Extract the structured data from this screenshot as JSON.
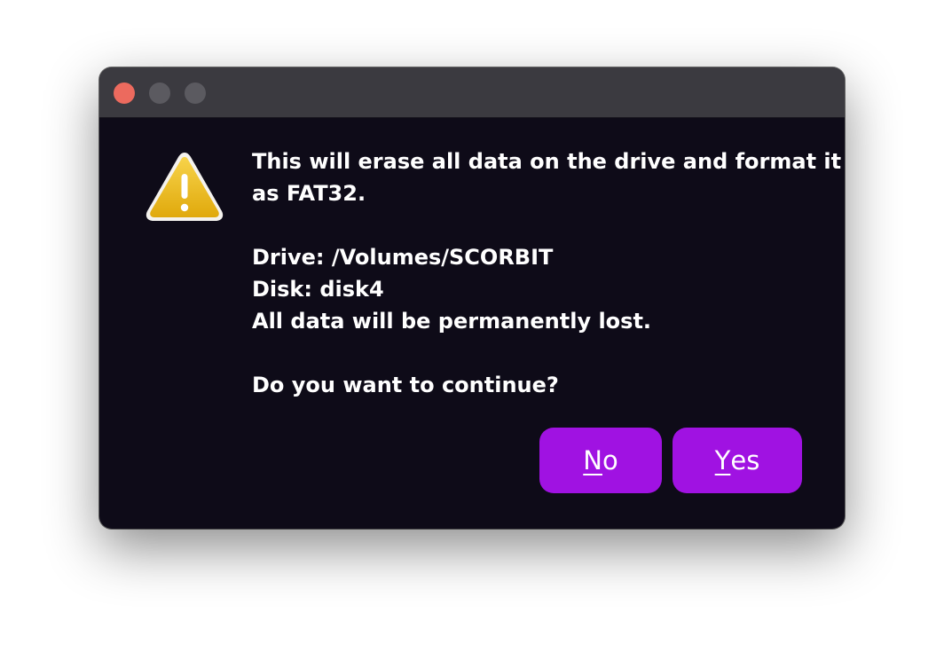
{
  "window": {
    "traffic_lights": [
      "close",
      "minimize",
      "zoom"
    ],
    "colors": {
      "background": "#0e0b18",
      "titlebar": "#3b3a40",
      "close": "#ec6a5e",
      "inactive": "#5b5a60",
      "button": "#a012e2"
    }
  },
  "dialog": {
    "icon": "warning-icon",
    "line1": "This will erase all data on the drive and format it",
    "line2": "as FAT32.",
    "drive": "Drive: /Volumes/SCORBIT",
    "disk": "Disk: disk4",
    "loss_warning": "All data will be permanently lost.",
    "question": "Do you want to continue?"
  },
  "buttons": {
    "no": {
      "mnemonic": "N",
      "rest": "o"
    },
    "yes": {
      "mnemonic": "Y",
      "rest": "es"
    }
  }
}
